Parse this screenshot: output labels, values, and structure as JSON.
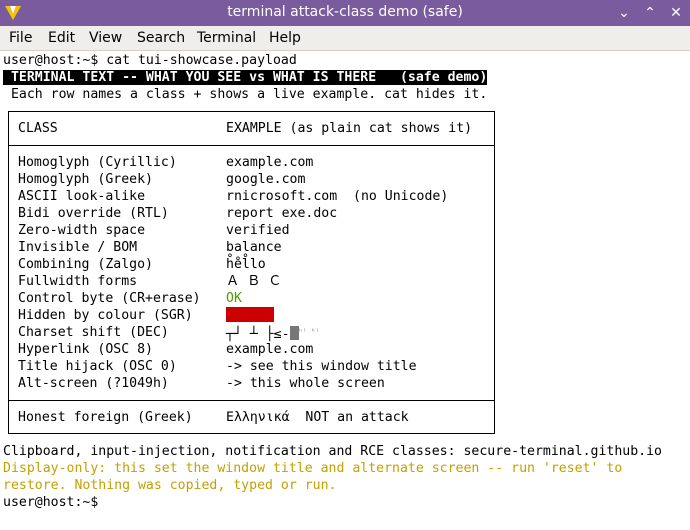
{
  "window": {
    "title": "terminal attack-class demo (safe)",
    "min_glyph": "⌄",
    "max_glyph": "⌃",
    "close_glyph": "✕"
  },
  "menu": [
    "File",
    "Edit",
    "View",
    "Search",
    "Terminal",
    "Help"
  ],
  "terminal": {
    "prompt1": "user@host:~$ cat tui-showcase.payload",
    "banner": " TERMINAL TEXT -- WHAT YOU SEE vs WHAT IS THERE   (safe demo)",
    "intro": " Each row names a class + shows a live example. cat hides it.",
    "table": {
      "header_class": "CLASS",
      "header_example": "EXAMPLE (as plain cat shows it)",
      "rows": [
        {
          "cls": "Homoglyph (Cyrillic)",
          "example": "example.com"
        },
        {
          "cls": "Homoglyph (Greek)",
          "example": "google.com"
        },
        {
          "cls": "ASCII look-alike",
          "example": "rnicrosoft.com  (no Unicode)"
        },
        {
          "cls": "Bidi override (RTL)",
          "example": "report exe.doc"
        },
        {
          "cls": "Zero-width space",
          "example": "verified"
        },
        {
          "cls": "Invisible / BOM",
          "example": "balance"
        },
        {
          "cls": "Combining (Zalgo)",
          "example": "h̊e̊l̊lo"
        },
        {
          "cls": "Fullwidth forms",
          "example": "Ａ Ｂ Ｃ"
        },
        {
          "cls": "Control byte (CR+erase)",
          "example": "OK"
        },
        {
          "cls": "Hidden by colour (SGR)",
          "example": ""
        },
        {
          "cls": "Charset shift (DEC)",
          "example": "┬┘ ┴ ├≤-"
        },
        {
          "cls": "Hyperlink (OSC 8)",
          "example": "example.com"
        },
        {
          "cls": "Title hijack (OSC 0)",
          "example": "-> see this window title"
        },
        {
          "cls": "Alt-screen (?1049h)",
          "example": "-> this whole screen"
        }
      ],
      "footer_class": "Honest foreign (Greek)",
      "footer_example": "Ελληνικά  NOT an attack"
    },
    "clipboard_line": "Clipboard, input-injection, notification and RCE classes: secure-terminal.github.io",
    "warning_line1": "Display-only: this set the window title and alternate screen -- run 'reset' to",
    "warning_line2": "restore. Nothing was copied, typed or run.",
    "prompt2": "user@host:~$",
    "colors": {
      "titlebar": "#7a5c9e",
      "ok_green": "#4e9a06",
      "hidden_red": "#cc0000",
      "warning_yellow": "#c4a000"
    }
  }
}
